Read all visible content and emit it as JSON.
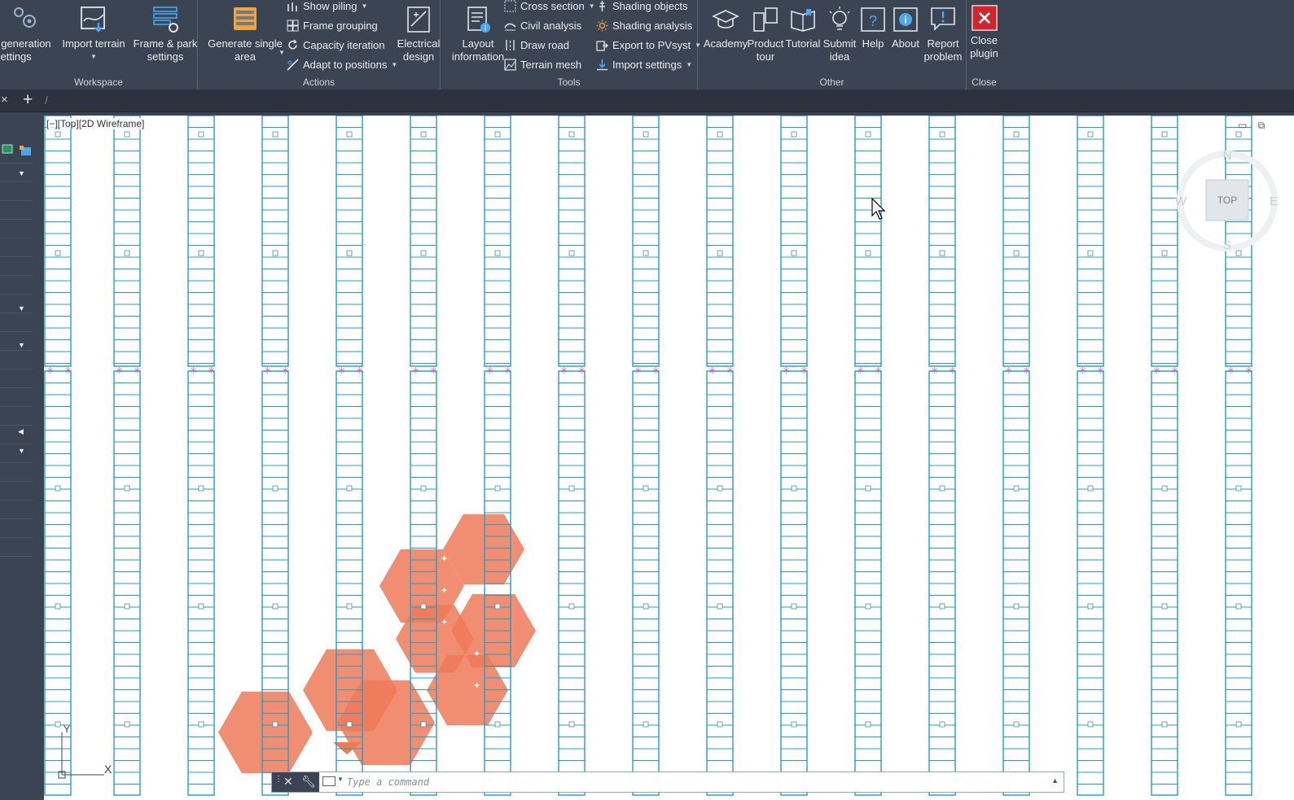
{
  "ribbon": {
    "workspace": {
      "label": "Workspace",
      "layout_generation": "t generation\nsettings",
      "import_terrain": "Import terrain",
      "frame_park": "Frame & park\nsettings"
    },
    "actions": {
      "label": "Actions",
      "generate_single": "Generate single\narea",
      "show_piling": "Show piling",
      "frame_grouping": "Frame grouping",
      "capacity_iteration": "Capacity iteration",
      "adapt_positions": "Adapt to positions",
      "electrical_design": "Electrical\ndesign"
    },
    "tools": {
      "label": "Tools",
      "layout_information": "Layout\ninformation",
      "cross_section": "Cross section",
      "civil_analysis": "Civil analysis",
      "draw_road": "Draw road",
      "terrain_mesh": "Terrain mesh",
      "shading_objects": "Shading objects",
      "shading_analysis": "Shading analysis",
      "export_pvsyst": "Export to PVsyst",
      "import_settings": "Import settings"
    },
    "other": {
      "label": "Other",
      "academy": "Academy",
      "product_tour": "Product\ntour",
      "tutorial": "Tutorial",
      "submit_idea": "Submit\nidea",
      "help": "Help",
      "about": "About",
      "report_problem": "Report\nproblem"
    },
    "close": {
      "label": "Close",
      "close_plugin": "Close\nplugin"
    }
  },
  "tabstrip": {
    "close": "×",
    "add": "+",
    "sep": "/"
  },
  "viewport": {
    "label": "[−][Top][2D Wireframe]",
    "compass": {
      "north": "N",
      "south": "S",
      "east": "E",
      "west": "W",
      "face": "TOP"
    },
    "ucs": {
      "x": "X",
      "y": "Y"
    }
  },
  "command_line": {
    "placeholder": "Type a command"
  },
  "colors": {
    "ribbon_bg": "#3b4453",
    "panel_line": "#1fa0c8",
    "shading_fill": "#ee7a58",
    "pile_marker": "#c05ad0",
    "close_red": "#d0252a"
  }
}
